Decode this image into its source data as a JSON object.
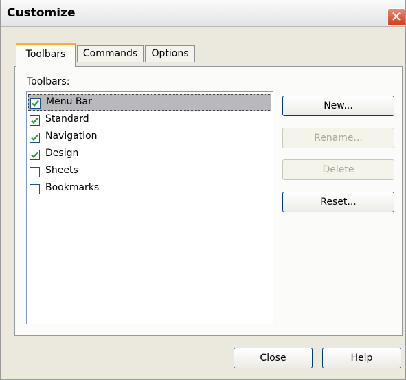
{
  "window": {
    "title": "Customize",
    "close_glyph": "✕"
  },
  "tabs": [
    {
      "label": "Toolbars",
      "active": true
    },
    {
      "label": "Commands",
      "active": false
    },
    {
      "label": "Options",
      "active": false
    }
  ],
  "toolbars_panel": {
    "group_label": "Toolbars:",
    "items": [
      {
        "label": "Menu Bar",
        "checked": true,
        "selected": true
      },
      {
        "label": "Standard",
        "checked": true,
        "selected": false
      },
      {
        "label": "Navigation",
        "checked": true,
        "selected": false
      },
      {
        "label": "Design",
        "checked": true,
        "selected": false
      },
      {
        "label": "Sheets",
        "checked": false,
        "selected": false
      },
      {
        "label": "Bookmarks",
        "checked": false,
        "selected": false
      }
    ],
    "buttons": {
      "new": {
        "label": "New...",
        "enabled": true
      },
      "rename": {
        "label": "Rename...",
        "enabled": false
      },
      "delete": {
        "label": "Delete",
        "enabled": false
      },
      "reset": {
        "label": "Reset...",
        "enabled": true
      }
    }
  },
  "footer": {
    "close_label": "Close",
    "help_label": "Help"
  },
  "colors": {
    "dialog_bg": "#ebe9de",
    "active_tab_accent": "#f2b42e",
    "selection": "#b9b9bd",
    "check_mark": "#21a121",
    "close_button": "#cd3d1a"
  }
}
